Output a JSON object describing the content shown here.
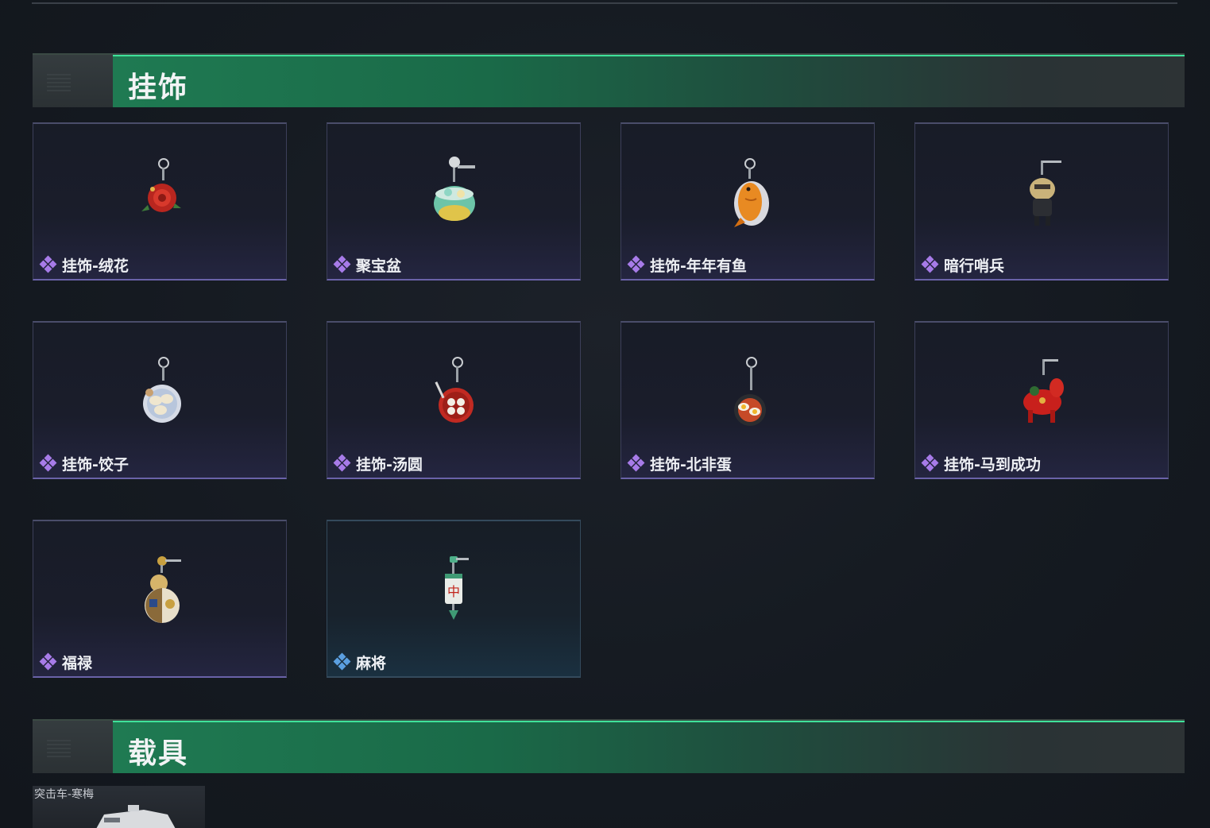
{
  "sections": {
    "pendants": {
      "title": "挂饰"
    },
    "vehicles": {
      "title": "载具"
    }
  },
  "pendants": [
    {
      "name": "挂饰-绒花",
      "rarity": "purple",
      "icon": "red-flower-charm-icon"
    },
    {
      "name": "聚宝盆",
      "rarity": "purple",
      "icon": "treasure-bowl-charm-icon"
    },
    {
      "name": "挂饰-年年有鱼",
      "rarity": "purple",
      "icon": "golden-fish-charm-icon"
    },
    {
      "name": "暗行哨兵",
      "rarity": "purple",
      "icon": "sentinel-doll-charm-icon"
    },
    {
      "name": "挂饰-饺子",
      "rarity": "purple",
      "icon": "dumpling-plate-charm-icon"
    },
    {
      "name": "挂饰-汤圆",
      "rarity": "purple",
      "icon": "tangyuan-bowl-charm-icon"
    },
    {
      "name": "挂饰-北非蛋",
      "rarity": "purple",
      "icon": "shakshuka-pan-charm-icon"
    },
    {
      "name": "挂饰-马到成功",
      "rarity": "purple",
      "icon": "red-horse-charm-icon"
    },
    {
      "name": "福禄",
      "rarity": "purple",
      "icon": "gourd-charm-icon"
    },
    {
      "name": "麻将",
      "rarity": "blue",
      "icon": "mahjong-tile-charm-icon"
    }
  ],
  "vehicle": {
    "label": "突击车-寒梅"
  },
  "colors": {
    "accent_green": "#3fe29a",
    "rarity_purple": "#a77be8",
    "rarity_blue": "#5b9fe0"
  }
}
